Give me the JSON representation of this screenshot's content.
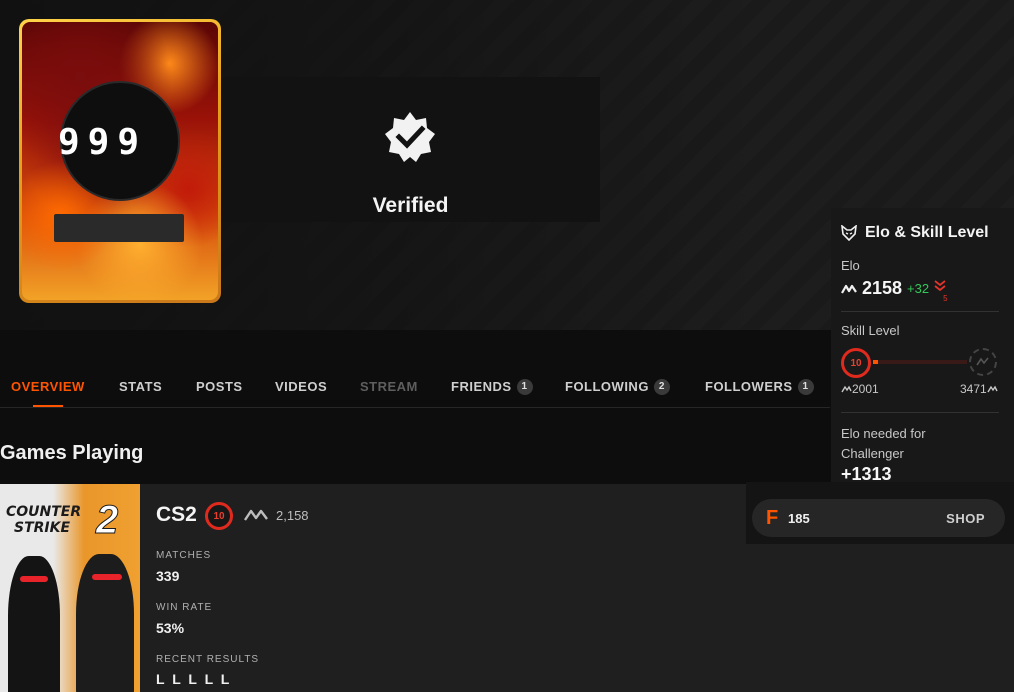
{
  "profile": {
    "avatar_text": "999",
    "verified_label": "Verified"
  },
  "tabs": [
    {
      "label": "OVERVIEW",
      "active": true
    },
    {
      "label": "STATS"
    },
    {
      "label": "POSTS"
    },
    {
      "label": "VIDEOS"
    },
    {
      "label": "STREAM",
      "disabled": true
    },
    {
      "label": "FRIENDS",
      "count": "1"
    },
    {
      "label": "FOLLOWING",
      "count": "2"
    },
    {
      "label": "FOLLOWERS",
      "count": "1"
    }
  ],
  "games_section": {
    "title": "Games Playing",
    "game": {
      "cover_line1": "COUNTER",
      "cover_line2": "STRIKE",
      "cover_number": "2",
      "name": "CS2",
      "level": "10",
      "elo": "2,158",
      "matches_label": "MATCHES",
      "matches_value": "339",
      "winrate_label": "WIN RATE",
      "winrate_value": "53%",
      "recent_label": "RECENT RESULTS",
      "recent_value": "L L L L L"
    }
  },
  "elo_panel": {
    "title": "Elo & Skill Level",
    "elo_label": "Elo",
    "elo_value": "2158",
    "elo_delta": "+32",
    "elo_down_count": "5",
    "skill_label": "Skill Level",
    "current_level": "10",
    "level_progress": 0.05,
    "range_min": "2001",
    "range_max": "3471",
    "needed_label": "Elo needed for Challenger",
    "needed_value": "+1313"
  },
  "shop": {
    "icon_letter": "F",
    "points": "185",
    "link_label": "SHOP"
  },
  "colors": {
    "accent": "#ff5500",
    "level_red": "#e02a1e",
    "positive": "#34c759",
    "negative": "#e5342b"
  }
}
